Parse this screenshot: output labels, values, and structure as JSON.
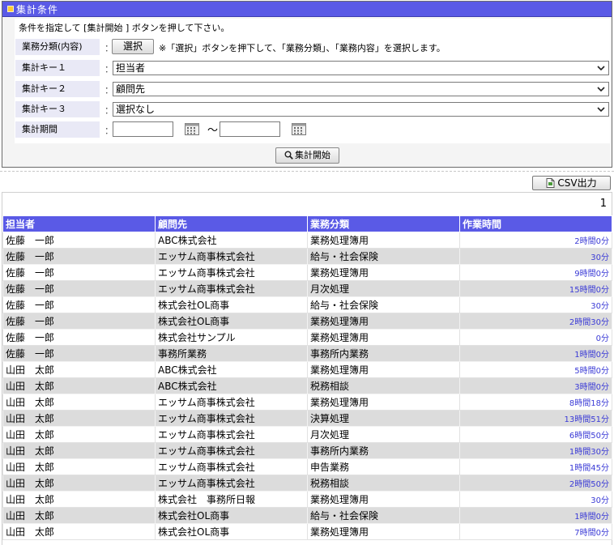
{
  "panel": {
    "title": "集計条件",
    "instruction": "条件を指定して [集計開始 ] ボタンを押して下さい。",
    "category_label": "業務分類(内容)",
    "select_button": "選択",
    "select_note": "※「選択」ボタンを押下して、「業務分類」、「業務内容」を選択します。",
    "key1_label": "集計キー１",
    "key1_value": "担当者",
    "key2_label": "集計キー２",
    "key2_value": "顧問先",
    "key3_label": "集計キー３",
    "key3_value": "選択なし",
    "period_label": "集計期間",
    "period_from": "",
    "period_to": "",
    "tilde": "～",
    "colon": "：",
    "start_button": "集計開始"
  },
  "csv_button": "CSV出力",
  "page_number": "1",
  "table": {
    "headers": [
      "担当者",
      "顧問先",
      "業務分類",
      "作業時間"
    ],
    "rows": [
      [
        "佐藤　一郎",
        "ABC株式会社",
        "業務処理簿用",
        "2時間0分"
      ],
      [
        "佐藤　一郎",
        "エッサム商事株式会社",
        "給与・社会保険",
        "30分"
      ],
      [
        "佐藤　一郎",
        "エッサム商事株式会社",
        "業務処理簿用",
        "9時間0分"
      ],
      [
        "佐藤　一郎",
        "エッサム商事株式会社",
        "月次処理",
        "15時間0分"
      ],
      [
        "佐藤　一郎",
        "株式会社OL商事",
        "給与・社会保険",
        "30分"
      ],
      [
        "佐藤　一郎",
        "株式会社OL商事",
        "業務処理簿用",
        "2時間30分"
      ],
      [
        "佐藤　一郎",
        "株式会社サンプル",
        "業務処理簿用",
        "0分"
      ],
      [
        "佐藤　一郎",
        "事務所業務",
        "事務所内業務",
        "1時間0分"
      ],
      [
        "山田　太郎",
        "ABC株式会社",
        "業務処理簿用",
        "5時間0分"
      ],
      [
        "山田　太郎",
        "ABC株式会社",
        "税務相談",
        "3時間0分"
      ],
      [
        "山田　太郎",
        "エッサム商事株式会社",
        "業務処理簿用",
        "8時間18分"
      ],
      [
        "山田　太郎",
        "エッサム商事株式会社",
        "決算処理",
        "13時間51分"
      ],
      [
        "山田　太郎",
        "エッサム商事株式会社",
        "月次処理",
        "6時間50分"
      ],
      [
        "山田　太郎",
        "エッサム商事株式会社",
        "事務所内業務",
        "1時間30分"
      ],
      [
        "山田　太郎",
        "エッサム商事株式会社",
        "申告業務",
        "1時間45分"
      ],
      [
        "山田　太郎",
        "エッサム商事株式会社",
        "税務相談",
        "2時間50分"
      ],
      [
        "山田　太郎",
        "株式会社　事務所日報",
        "業務処理簿用",
        "30分"
      ],
      [
        "山田　太郎",
        "株式会社OL商事",
        "給与・社会保険",
        "1時間0分"
      ],
      [
        "山田　太郎",
        "株式会社OL商事",
        "業務処理簿用",
        "7時間0分"
      ]
    ]
  }
}
